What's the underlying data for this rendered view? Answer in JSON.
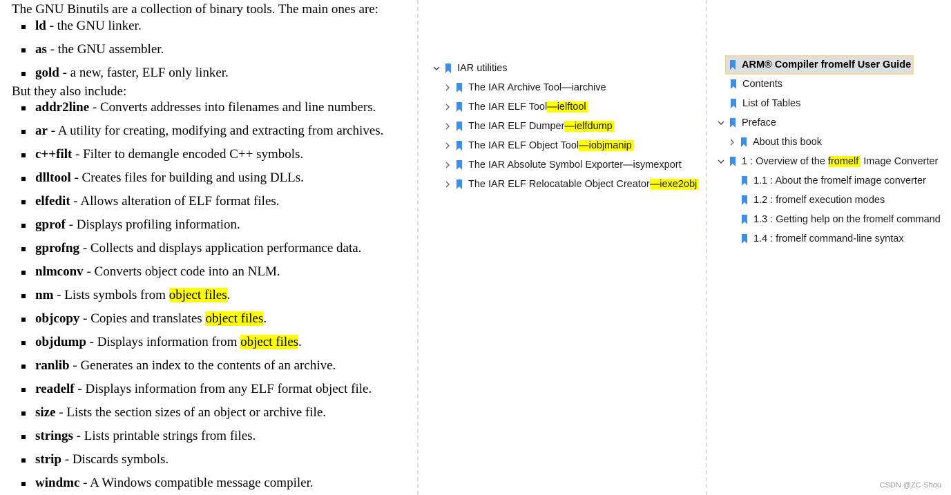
{
  "left": {
    "intro": "The GNU Binutils are a collection of binary tools. The main ones are:",
    "main_tools": [
      {
        "cmd": "ld",
        "desc": " - the GNU linker."
      },
      {
        "cmd": "as",
        "desc": " - the GNU assembler."
      },
      {
        "cmd": "gold",
        "desc": " - a new, faster, ELF only linker."
      }
    ],
    "also": "But they also include:",
    "tools": [
      {
        "cmd": "addr2line",
        "desc": " - Converts addresses into filenames and line numbers.",
        "pre": "",
        "hl": "",
        "post": ""
      },
      {
        "cmd": "ar",
        "desc": " - A utility for creating, modifying and extracting from archives.",
        "pre": "",
        "hl": "",
        "post": ""
      },
      {
        "cmd": "c++filt",
        "desc": " - Filter to demangle encoded C++ symbols.",
        "pre": "",
        "hl": "",
        "post": ""
      },
      {
        "cmd": "dlltool",
        "desc": " - Creates files for building and using DLLs.",
        "pre": "",
        "hl": "",
        "post": ""
      },
      {
        "cmd": "elfedit",
        "desc": " - Allows alteration of ELF format files.",
        "pre": "",
        "hl": "",
        "post": ""
      },
      {
        "cmd": "gprof",
        "desc": " - Displays profiling information.",
        "pre": "",
        "hl": "",
        "post": ""
      },
      {
        "cmd": "gprofng",
        "desc": " - Collects and displays application performance data.",
        "pre": "",
        "hl": "",
        "post": ""
      },
      {
        "cmd": "nlmconv",
        "desc": " - Converts object code into an NLM.",
        "pre": "",
        "hl": "",
        "post": ""
      },
      {
        "cmd": "nm",
        "desc": "",
        "pre": " - Lists symbols from ",
        "hl": "object files",
        "post": "."
      },
      {
        "cmd": "objcopy",
        "desc": "",
        "pre": " - Copies and translates ",
        "hl": "object files",
        "post": "."
      },
      {
        "cmd": "objdump",
        "desc": "",
        "pre": " - Displays information from ",
        "hl": "object files",
        "post": "."
      },
      {
        "cmd": "ranlib",
        "desc": " - Generates an index to the contents of an archive.",
        "pre": "",
        "hl": "",
        "post": ""
      },
      {
        "cmd": "readelf",
        "desc": " - Displays information from any ELF format object file.",
        "pre": "",
        "hl": "",
        "post": ""
      },
      {
        "cmd": "size",
        "desc": " - Lists the section sizes of an object or archive file.",
        "pre": "",
        "hl": "",
        "post": ""
      },
      {
        "cmd": "strings",
        "desc": " - Lists printable strings from files.",
        "pre": "",
        "hl": "",
        "post": ""
      },
      {
        "cmd": "strip",
        "desc": " - Discards symbols.",
        "pre": "",
        "hl": "",
        "post": ""
      },
      {
        "cmd": "windmc",
        "desc": " - A Windows compatible message compiler.",
        "pre": "",
        "hl": "",
        "post": ""
      }
    ]
  },
  "iar_tree": {
    "root": "IAR utilities",
    "items": [
      {
        "pre": "The IAR Archive Tool—iarchive",
        "hl": ""
      },
      {
        "pre": "The IAR ELF Tool",
        "hl": "—ielftool"
      },
      {
        "pre": "The IAR ELF Dumper",
        "hl": "—ielfdump"
      },
      {
        "pre": "The IAR ELF Object Tool",
        "hl": "—iobjmanip"
      },
      {
        "pre": "The IAR Absolute Symbol Exporter—isymexport",
        "hl": ""
      },
      {
        "pre": "The IAR ELF Relocatable Object Creator",
        "hl": "—iexe2obj"
      }
    ]
  },
  "arm_tree": {
    "title": "ARM® Compiler fromelf User Guide",
    "contents": "Contents",
    "list_of_tables": "List of Tables",
    "preface": "Preface",
    "about_book": "About this book",
    "chapter1_pre": "1 : Overview of the ",
    "chapter1_hl": "fromelf",
    "chapter1_post": " Image Converter",
    "sections": [
      "1.1 : About the fromelf image converter",
      "1.2 : fromelf execution modes",
      "1.3 : Getting help on the fromelf command",
      "1.4 : fromelf command-line syntax"
    ]
  },
  "watermark": "CSDN @ZC·Shou",
  "colors": {
    "highlight": "#ffff00",
    "bookmark_icon": "#3d8fe6",
    "divider": "#d8dce6"
  }
}
